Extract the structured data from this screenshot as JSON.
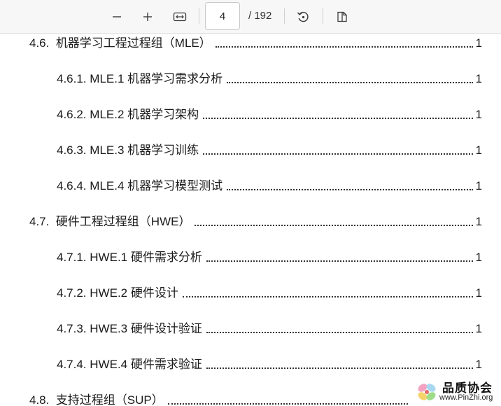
{
  "toolbar": {
    "current_page": "4",
    "total_pages": "/ 192"
  },
  "toc": [
    {
      "level": 1,
      "number": "4.6.",
      "title": "机器学习工程过程组（MLE）",
      "page": "1"
    },
    {
      "level": 2,
      "number": "4.6.1.",
      "title": "MLE.1 机器学习需求分析",
      "page": "1"
    },
    {
      "level": 2,
      "number": "4.6.2.",
      "title": "MLE.2 机器学习架构",
      "page": "1"
    },
    {
      "level": 2,
      "number": "4.6.3.",
      "title": "MLE.3 机器学习训练",
      "page": "1"
    },
    {
      "level": 2,
      "number": "4.6.4.",
      "title": "MLE.4 机器学习模型测试",
      "page": "1"
    },
    {
      "level": 1,
      "number": "4.7.",
      "title": "硬件工程过程组（HWE）",
      "page": "1"
    },
    {
      "level": 2,
      "number": "4.7.1.",
      "title": "HWE.1 硬件需求分析",
      "page": "1"
    },
    {
      "level": 2,
      "number": "4.7.2.",
      "title": "HWE.2 硬件设计",
      "page": "1"
    },
    {
      "level": 2,
      "number": "4.7.3.",
      "title": "HWE.3 硬件设计验证",
      "page": "1"
    },
    {
      "level": 2,
      "number": "4.7.4.",
      "title": "HWE.4 硬件需求验证",
      "page": "1"
    },
    {
      "level": 1,
      "number": "4.8.",
      "title": "支持过程组（SUP）",
      "page": ""
    }
  ],
  "watermark": {
    "name": "品质协会",
    "url": "www.PinZhi.org"
  },
  "colors": {
    "toolbar_bg": "#f7f7f7",
    "text": "#1a1a1a"
  }
}
